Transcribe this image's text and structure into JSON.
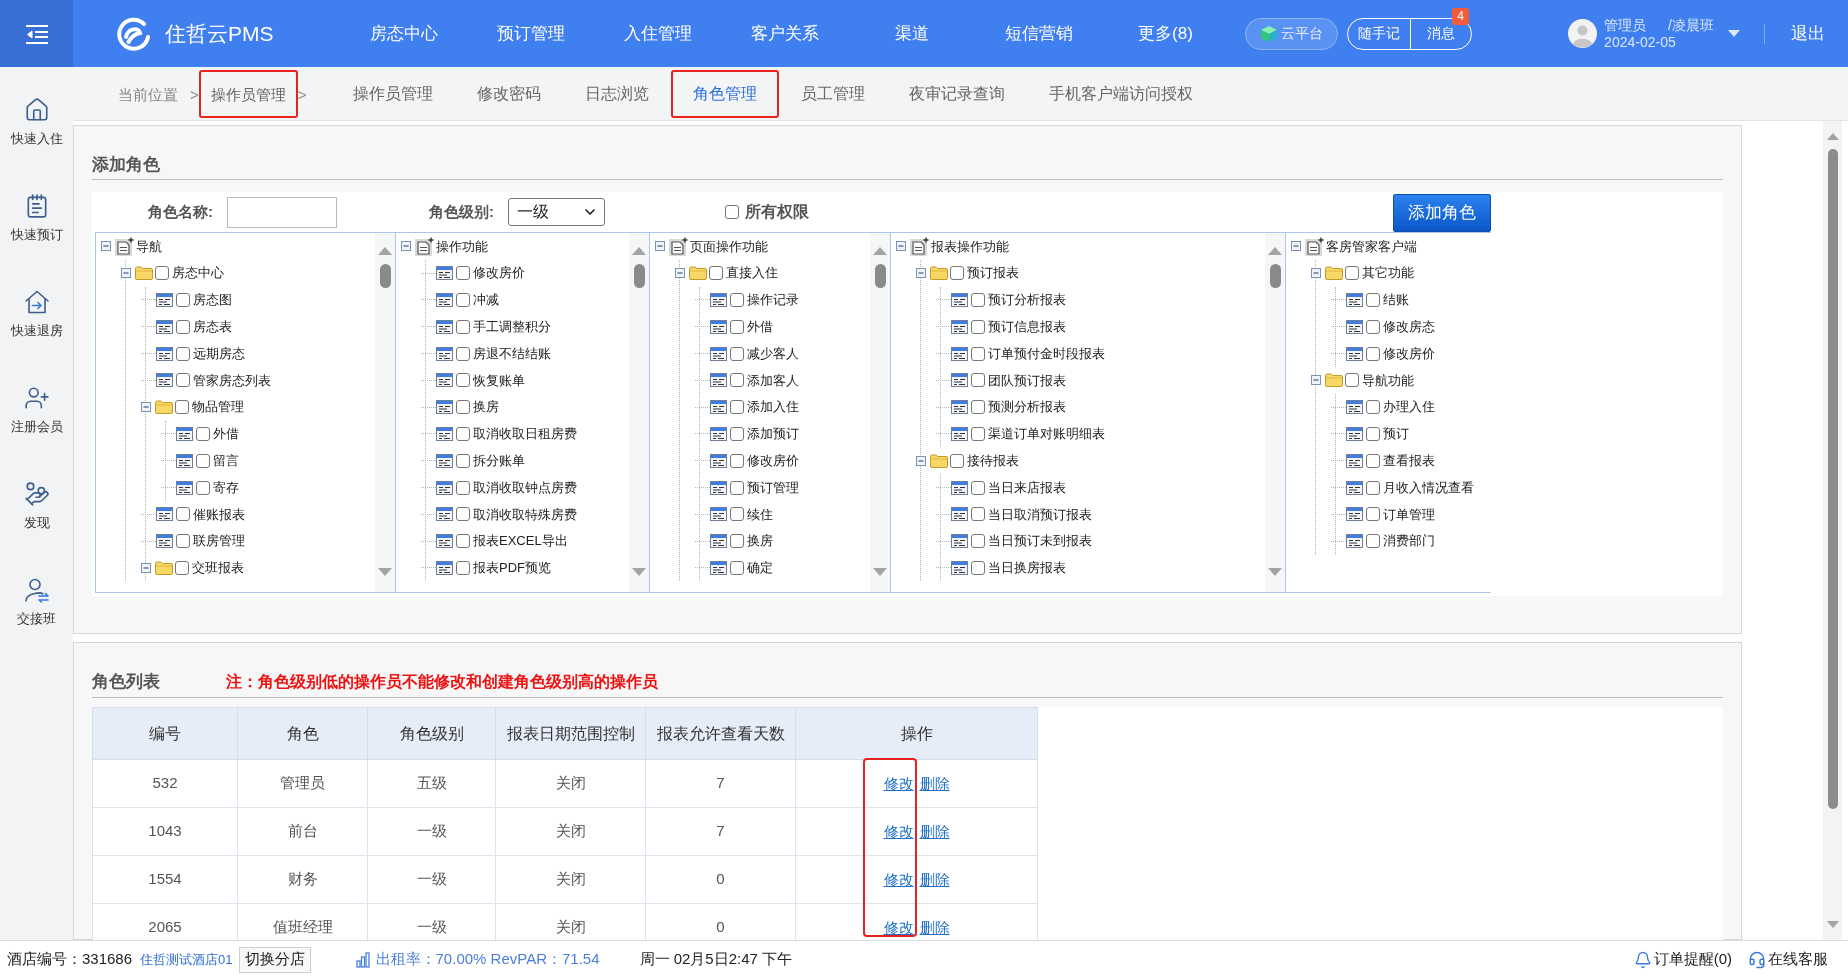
{
  "top_bar": {
    "logo": "住哲云PMS",
    "nav": [
      "房态中心",
      "预订管理",
      "入住管理",
      "客户关系",
      "渠道",
      "短信营销",
      "更多(8)"
    ],
    "cloud_button": "云平台",
    "note_button": "随手记",
    "message_button": {
      "label": "消息",
      "badge": "4"
    },
    "user": {
      "name": "管理员",
      "shift": "/凌晨班",
      "date": "2024-02-05"
    },
    "logout": "退出"
  },
  "sidebar": {
    "items": [
      "快速入住",
      "快速预订",
      "快速退房",
      "注册会员",
      "发现",
      "交接班"
    ]
  },
  "breadcrumb": [
    {
      "label": "当前位置",
      "separator": ">",
      "highlighted": false
    },
    {
      "label": "操作员管理",
      "separator": ">",
      "highlighted": true
    }
  ],
  "tabs": [
    {
      "label": "操作员管理",
      "selected": false,
      "highlighted": false
    },
    {
      "label": "修改密码",
      "selected": false,
      "highlighted": false
    },
    {
      "label": "日志浏览",
      "selected": false,
      "highlighted": false
    },
    {
      "label": "角色管理",
      "selected": true,
      "highlighted": true
    },
    {
      "label": "员工管理",
      "selected": false,
      "highlighted": false
    },
    {
      "label": "夜审记录查询",
      "selected": false,
      "highlighted": false
    },
    {
      "label": "手机客户端访问授权",
      "selected": false,
      "highlighted": false
    }
  ],
  "add_role": {
    "title": "添加角色",
    "name_field": {
      "label": "角色名称:"
    },
    "level_field": {
      "label": "角色级别:",
      "value": "一级"
    },
    "all_permissions": {
      "label": "所有权限",
      "checked": false
    },
    "submit_button": "添加角色",
    "tree_columns": [
      {
        "scrollable": true,
        "tree": {
          "kind": "root",
          "label": "导航",
          "expanded": true,
          "children": [
            {
              "kind": "folder",
              "label": "房态中心",
              "expanded": true,
              "checked": false,
              "children": [
                {
                  "kind": "leaf",
                  "label": "房态图",
                  "checked": false
                },
                {
                  "kind": "leaf",
                  "label": "房态表",
                  "checked": false
                },
                {
                  "kind": "leaf",
                  "label": "远期房态",
                  "checked": false
                },
                {
                  "kind": "leaf",
                  "label": "管家房态列表",
                  "checked": false
                },
                {
                  "kind": "folder",
                  "label": "物品管理",
                  "expanded": true,
                  "checked": false,
                  "children": [
                    {
                      "kind": "leaf",
                      "label": "外借",
                      "checked": false
                    },
                    {
                      "kind": "leaf",
                      "label": "留言",
                      "checked": false
                    },
                    {
                      "kind": "leaf",
                      "label": "寄存",
                      "checked": false
                    }
                  ]
                },
                {
                  "kind": "leaf",
                  "label": "催账报表",
                  "checked": false
                },
                {
                  "kind": "leaf",
                  "label": "联房管理",
                  "checked": false
                },
                {
                  "kind": "folder",
                  "label": "交班报表",
                  "expanded": true,
                  "checked": false
                }
              ]
            }
          ]
        }
      },
      {
        "scrollable": true,
        "tree": {
          "kind": "root",
          "label": "操作功能",
          "expanded": true,
          "children": [
            {
              "kind": "leaf",
              "label": "修改房价",
              "checked": false
            },
            {
              "kind": "leaf",
              "label": "冲减",
              "checked": false
            },
            {
              "kind": "leaf",
              "label": "手工调整积分",
              "checked": false
            },
            {
              "kind": "leaf",
              "label": "房退不结结账",
              "checked": false
            },
            {
              "kind": "leaf",
              "label": "恢复账单",
              "checked": false
            },
            {
              "kind": "leaf",
              "label": "换房",
              "checked": false
            },
            {
              "kind": "leaf",
              "label": "取消收取日租房费",
              "checked": false
            },
            {
              "kind": "leaf",
              "label": "拆分账单",
              "checked": false
            },
            {
              "kind": "leaf",
              "label": "取消收取钟点房费",
              "checked": false
            },
            {
              "kind": "leaf",
              "label": "取消收取特殊房费",
              "checked": false
            },
            {
              "kind": "leaf",
              "label": "报表EXCEL导出",
              "checked": false
            },
            {
              "kind": "leaf",
              "label": "报表PDF预览",
              "checked": false
            }
          ]
        }
      },
      {
        "scrollable": true,
        "tree": {
          "kind": "root",
          "label": "页面操作功能",
          "expanded": true,
          "children": [
            {
              "kind": "folder",
              "label": "直接入住",
              "expanded": true,
              "checked": false,
              "children": [
                {
                  "kind": "leaf",
                  "label": "操作记录",
                  "checked": false
                },
                {
                  "kind": "leaf",
                  "label": "外借",
                  "checked": false
                },
                {
                  "kind": "leaf",
                  "label": "减少客人",
                  "checked": false
                },
                {
                  "kind": "leaf",
                  "label": "添加客人",
                  "checked": false
                },
                {
                  "kind": "leaf",
                  "label": "添加入住",
                  "checked": false
                },
                {
                  "kind": "leaf",
                  "label": "添加预订",
                  "checked": false
                },
                {
                  "kind": "leaf",
                  "label": "修改房价",
                  "checked": false
                },
                {
                  "kind": "leaf",
                  "label": "预订管理",
                  "checked": false
                },
                {
                  "kind": "leaf",
                  "label": "续住",
                  "checked": false
                },
                {
                  "kind": "leaf",
                  "label": "换房",
                  "checked": false
                },
                {
                  "kind": "leaf",
                  "label": "确定",
                  "checked": false
                }
              ]
            }
          ]
        }
      },
      {
        "scrollable": true,
        "tree": {
          "kind": "root",
          "label": "报表操作功能",
          "expanded": true,
          "children": [
            {
              "kind": "folder",
              "label": "预订报表",
              "expanded": true,
              "checked": false,
              "children": [
                {
                  "kind": "leaf",
                  "label": "预订分析报表",
                  "checked": false
                },
                {
                  "kind": "leaf",
                  "label": "预订信息报表",
                  "checked": false
                },
                {
                  "kind": "leaf",
                  "label": "订单预付金时段报表",
                  "checked": false
                },
                {
                  "kind": "leaf",
                  "label": "团队预订报表",
                  "checked": false
                },
                {
                  "kind": "leaf",
                  "label": "预测分析报表",
                  "checked": false
                },
                {
                  "kind": "leaf",
                  "label": "渠道订单对账明细表",
                  "checked": false
                }
              ]
            },
            {
              "kind": "folder",
              "label": "接待报表",
              "expanded": true,
              "checked": false,
              "children": [
                {
                  "kind": "leaf",
                  "label": "当日来店报表",
                  "checked": false
                },
                {
                  "kind": "leaf",
                  "label": "当日取消预订报表",
                  "checked": false
                },
                {
                  "kind": "leaf",
                  "label": "当日预订未到报表",
                  "checked": false
                },
                {
                  "kind": "leaf",
                  "label": "当日换房报表",
                  "checked": false
                }
              ]
            }
          ]
        }
      },
      {
        "scrollable": false,
        "tree": {
          "kind": "root",
          "label": "客房管家客户端",
          "expanded": true,
          "children": [
            {
              "kind": "folder",
              "label": "其它功能",
              "expanded": true,
              "checked": false,
              "children": [
                {
                  "kind": "leaf",
                  "label": "结账",
                  "checked": false
                },
                {
                  "kind": "leaf",
                  "label": "修改房态",
                  "checked": false
                },
                {
                  "kind": "leaf",
                  "label": "修改房价",
                  "checked": false
                }
              ]
            },
            {
              "kind": "folder",
              "label": "导航功能",
              "expanded": true,
              "checked": false,
              "children": [
                {
                  "kind": "leaf",
                  "label": "办理入住",
                  "checked": false
                },
                {
                  "kind": "leaf",
                  "label": "预订",
                  "checked": false
                },
                {
                  "kind": "leaf",
                  "label": "查看报表",
                  "checked": false
                },
                {
                  "kind": "leaf",
                  "label": "月收入情况查看",
                  "checked": false
                },
                {
                  "kind": "leaf",
                  "label": "订单管理",
                  "checked": false
                },
                {
                  "kind": "leaf",
                  "label": "消费部门",
                  "checked": false
                }
              ]
            }
          ]
        }
      }
    ]
  },
  "role_list": {
    "title": "角色列表",
    "note": "注：角色级别低的操作员不能修改和创建角色级别高的操作员",
    "table": {
      "columns": [
        "编号",
        "角色",
        "角色级别",
        "报表日期范围控制",
        "报表允许查看天数",
        "操作"
      ],
      "rows": [
        {
          "cells": [
            "532",
            "管理员",
            "五级",
            "关闭",
            "7"
          ],
          "actions": [
            "修改",
            "删除"
          ]
        },
        {
          "cells": [
            "1043",
            "前台",
            "一级",
            "关闭",
            "7"
          ],
          "actions": [
            "修改",
            "删除"
          ]
        },
        {
          "cells": [
            "1554",
            "财务",
            "一级",
            "关闭",
            "0"
          ],
          "actions": [
            "修改",
            "删除"
          ]
        },
        {
          "cells": [
            "2065",
            "值班经理",
            "一级",
            "关闭",
            "0"
          ],
          "actions": [
            "修改",
            "删除"
          ]
        }
      ],
      "edit_links_highlighted": true
    }
  },
  "status_bar": {
    "hotel_id": "酒店编号：331686",
    "hotel_name": "住哲测试酒店01",
    "switch_button": "切换分店",
    "occupancy": "出租率：70.00% RevPAR：71.54",
    "datetime": "周一 02月5日2:47 下午",
    "order_alerts": "订单提醒(0)",
    "support": "在线客服"
  }
}
